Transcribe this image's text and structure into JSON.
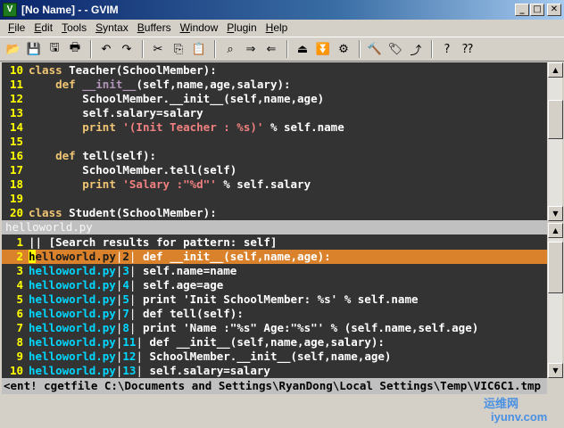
{
  "window": {
    "title": "[No Name] - - GVIM",
    "icon_name": "vim-icon",
    "minimize_glyph": "_",
    "maximize_glyph": "□",
    "close_glyph": "✕"
  },
  "menu": [
    {
      "label": "File",
      "underline": "F",
      "rest": "ile"
    },
    {
      "label": "Edit",
      "underline": "E",
      "rest": "dit"
    },
    {
      "label": "Tools",
      "underline": "T",
      "rest": "ools"
    },
    {
      "label": "Syntax",
      "underline": "S",
      "rest": "yntax"
    },
    {
      "label": "Buffers",
      "underline": "B",
      "rest": "uffers"
    },
    {
      "label": "Window",
      "underline": "W",
      "rest": "indow"
    },
    {
      "label": "Plugin",
      "underline": "P",
      "rest": "lugin"
    },
    {
      "label": "Help",
      "underline": "H",
      "rest": "elp"
    }
  ],
  "toolbar": [
    {
      "icon": "open-folder-icon",
      "glyph": "📂"
    },
    {
      "icon": "save-icon",
      "glyph": "💾"
    },
    {
      "icon": "save-all-icon",
      "glyph": "🖫"
    },
    {
      "icon": "print-icon",
      "glyph": "🖶"
    },
    {
      "sep": true
    },
    {
      "icon": "undo-icon",
      "glyph": "↶"
    },
    {
      "icon": "redo-icon",
      "glyph": "↷"
    },
    {
      "sep": true
    },
    {
      "icon": "cut-icon",
      "glyph": "✂"
    },
    {
      "icon": "copy-icon",
      "glyph": "⎘"
    },
    {
      "icon": "paste-icon",
      "glyph": "📋"
    },
    {
      "sep": true
    },
    {
      "icon": "find-replace-icon",
      "glyph": "⌕"
    },
    {
      "icon": "find-next-icon",
      "glyph": "⇒"
    },
    {
      "icon": "find-prev-icon",
      "glyph": "⇐"
    },
    {
      "sep": true
    },
    {
      "icon": "load-session-icon",
      "glyph": "⏏"
    },
    {
      "icon": "save-session-icon",
      "glyph": "⏬"
    },
    {
      "icon": "run-script-icon",
      "glyph": "⚙"
    },
    {
      "sep": true
    },
    {
      "icon": "make-icon",
      "glyph": "🔨"
    },
    {
      "icon": "build-tags-icon",
      "glyph": "🏷"
    },
    {
      "icon": "jump-tag-icon",
      "glyph": "⤴"
    },
    {
      "sep": true
    },
    {
      "icon": "help-icon",
      "glyph": "?"
    },
    {
      "icon": "find-help-icon",
      "glyph": "⁇"
    }
  ],
  "upper_pane": [
    {
      "num": "10",
      "parts": [
        [
          "kw",
          "class "
        ],
        [
          "cls",
          "Teacher(SchoolMember):"
        ]
      ]
    },
    {
      "num": "11",
      "parts": [
        [
          "code",
          "    "
        ],
        [
          "kw",
          "def "
        ],
        [
          "fn",
          "__init__"
        ],
        [
          "code",
          "(self,name,age,salary):"
        ]
      ]
    },
    {
      "num": "12",
      "parts": [
        [
          "code",
          "        SchoolMember.__init__(self,name,age)"
        ]
      ]
    },
    {
      "num": "13",
      "parts": [
        [
          "code",
          "        self.salary=salary"
        ]
      ]
    },
    {
      "num": "14",
      "parts": [
        [
          "code",
          "        "
        ],
        [
          "kw",
          "print "
        ],
        [
          "str",
          "'(Init Teacher : %s)'"
        ],
        [
          "code",
          " % self.name"
        ]
      ]
    },
    {
      "num": "15",
      "parts": [
        [
          "code",
          ""
        ]
      ]
    },
    {
      "num": "16",
      "parts": [
        [
          "code",
          "    "
        ],
        [
          "kw",
          "def "
        ],
        [
          "code",
          "tell(self):"
        ]
      ]
    },
    {
      "num": "17",
      "parts": [
        [
          "code",
          "        SchoolMember.tell(self)"
        ]
      ]
    },
    {
      "num": "18",
      "parts": [
        [
          "code",
          "        "
        ],
        [
          "kw",
          "print "
        ],
        [
          "str",
          "'Salary :\"%d\"'"
        ],
        [
          "code",
          " % self.salary"
        ]
      ]
    },
    {
      "num": "19",
      "parts": [
        [
          "code",
          ""
        ]
      ]
    },
    {
      "num": "20",
      "parts": [
        [
          "kw",
          "class "
        ],
        [
          "cls",
          "Student(SchoolMember):"
        ]
      ]
    }
  ],
  "upper_status": "helloworld.py",
  "quickfix": [
    {
      "num": "1",
      "header": "|| [Search results for pattern: self]"
    },
    {
      "num": "2",
      "file": "helloworld.py",
      "lnum": "2",
      "text": " def __init__(self,name,age):",
      "selected": true
    },
    {
      "num": "3",
      "file": "helloworld.py",
      "lnum": "3",
      "text": " self.name=name"
    },
    {
      "num": "4",
      "file": "helloworld.py",
      "lnum": "4",
      "text": " self.age=age"
    },
    {
      "num": "5",
      "file": "helloworld.py",
      "lnum": "5",
      "text": " print 'Init SchoolMember: %s' % self.name"
    },
    {
      "num": "6",
      "file": "helloworld.py",
      "lnum": "7",
      "text": " def tell(self):"
    },
    {
      "num": "7",
      "file": "helloworld.py",
      "lnum": "8",
      "text": " print 'Name :\"%s\" Age:\"%s\"' % (self.name,self.age)"
    },
    {
      "num": "8",
      "file": "helloworld.py",
      "lnum": "11",
      "text": " def __init__(self,name,age,salary):"
    },
    {
      "num": "9",
      "file": "helloworld.py",
      "lnum": "12",
      "text": " SchoolMember.__init__(self,name,age)"
    },
    {
      "num": "10",
      "file": "helloworld.py",
      "lnum": "13",
      "text": " self.salary=salary"
    }
  ],
  "cmdline": "<ent! cgetfile C:\\Documents and Settings\\RyanDong\\Local Settings\\Temp\\VIC6C1.tmp",
  "scroll": {
    "upper_thumb_position": 0.25,
    "lower_thumb_position": 0.05
  },
  "colors": {
    "background": "#333333",
    "line_number": "#ffff00",
    "keyword": "#f0c674",
    "string": "#f08080",
    "filename": "#00d7ff",
    "selection": "#d9822b"
  },
  "watermark": {
    "line1": "运维网",
    "line2": "iyunv.com"
  }
}
